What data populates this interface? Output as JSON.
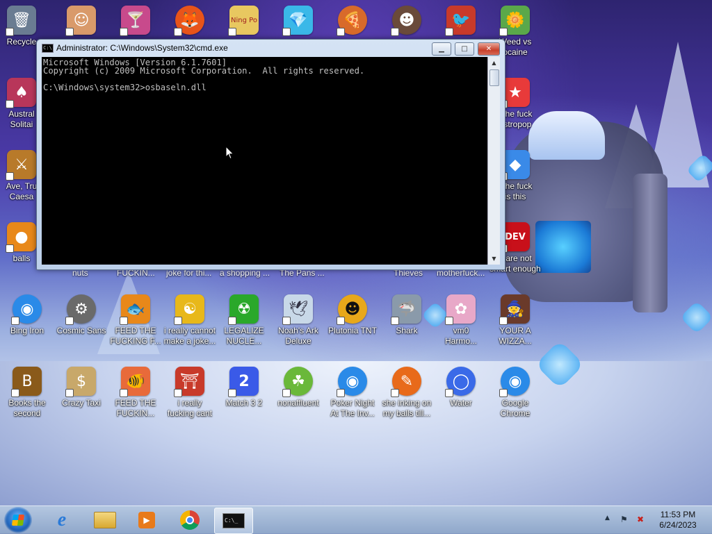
{
  "desktop": {
    "row_top": [
      {
        "label": "Recycle",
        "color": "#6a7c92",
        "glyph": "🗑"
      },
      {
        "label": "",
        "color": "#d99a6a",
        "glyph": "☺"
      },
      {
        "label": "",
        "color": "#c84a8c",
        "glyph": "🍸"
      },
      {
        "label": "",
        "color": "#e8541a",
        "glyph": "🦊"
      },
      {
        "label": "",
        "color": "#e8c860",
        "glyph": "Ning Po"
      },
      {
        "label": "",
        "color": "#3ab8e8",
        "glyph": "💎"
      },
      {
        "label": "",
        "color": "#d86a2a",
        "glyph": "🍕"
      },
      {
        "label": "",
        "color": "#6a4a3a",
        "glyph": "☻"
      },
      {
        "label": "",
        "color": "#c83a2a",
        "glyph": "🐦"
      },
      {
        "label": "Weed vs\nocaine",
        "color": "#5aa84a",
        "glyph": "🌼"
      }
    ],
    "left_col": [
      {
        "label": "Austral\nSolitai",
        "color": "#b8365a",
        "glyph": "♠"
      },
      {
        "label": "Ave, Tru\nCaesa",
        "color": "#b87a2a",
        "glyph": "⚔"
      },
      {
        "label": "balls",
        "color": "#e8881a",
        "glyph": "●"
      }
    ],
    "right_col": [
      {
        "label": "t the fuck\nastropop",
        "color": "#e83a3a",
        "glyph": "★"
      },
      {
        "label": "t the fuck\nis this",
        "color": "#3a8ae8",
        "glyph": "◆"
      },
      {
        "label": "u are not\nsmart enough",
        "color": "#c8101a",
        "glyph": "DEV"
      }
    ],
    "row_hidden_labels": [
      "nuts",
      "FUCKIN...",
      "joke for thi...",
      "a shopping ...",
      "The Pans ...",
      "Thieves",
      "motherfuck..."
    ],
    "row_middle": [
      {
        "label": "Bing Iron",
        "color": "#2a8ae8",
        "glyph": "◉"
      },
      {
        "label": "Cosmic Sans",
        "color": "#6a6a6a",
        "glyph": "⚙"
      },
      {
        "label": "FEED THE\nFUCKING F...",
        "color": "#e8881a",
        "glyph": "🐟"
      },
      {
        "label": "i really cannot\nmake a joke...",
        "color": "#e8b81a",
        "glyph": "☯"
      },
      {
        "label": "LEGALIZE\nNUCLE...",
        "color": "#2aa82a",
        "glyph": "☢"
      },
      {
        "label": "Noah's Ark\nDeluxe",
        "color": "#c8d8e8",
        "glyph": "🕊"
      },
      {
        "label": "Plutonia TNT",
        "color": "#e8a81a",
        "glyph": "☻"
      },
      {
        "label": "Shark",
        "color": "#8a9aaa",
        "glyph": "🦈"
      },
      {
        "label": "vm0\nHarmo...",
        "color": "#e8a8c8",
        "glyph": "✿"
      },
      {
        "label": "YOUR A\nWIZZA...",
        "color": "#6a3a2a",
        "glyph": "🧙"
      }
    ],
    "row_bottom": [
      {
        "label": "Books the\nsecond",
        "color": "#8a5a1a",
        "glyph": "B"
      },
      {
        "label": "Crazy Taxi",
        "color": "#c8a86a",
        "glyph": "$"
      },
      {
        "label": "FEED THE\nFUCKIN...",
        "color": "#e86a3a",
        "glyph": "🐠"
      },
      {
        "label": "i really\nfucking cant",
        "color": "#c83a2a",
        "glyph": "⛩"
      },
      {
        "label": "Match 3 2",
        "color": "#3a5ae8",
        "glyph": "2"
      },
      {
        "label": "nonaffluent",
        "color": "#6ab83a",
        "glyph": "☘"
      },
      {
        "label": "Poker Night\nAt The Inv...",
        "color": "#2a8ae8",
        "glyph": "◉"
      },
      {
        "label": "she inking on\nmy balls till...",
        "color": "#e86a1a",
        "glyph": "✎"
      },
      {
        "label": "Water",
        "color": "#3a6ae8",
        "glyph": "◯"
      },
      {
        "label": "Google\nChrome",
        "color": "#2a8ae8",
        "glyph": "◉"
      }
    ]
  },
  "cmd": {
    "title": "Administrator: C:\\Windows\\System32\\cmd.exe",
    "icon_text": "C:\\",
    "minimize": "▁",
    "maximize": "□",
    "close": "✕",
    "console_text": "Microsoft Windows [Version 6.1.7601]\nCopyright (c) 2009 Microsoft Corporation.  All rights reserved.\n\nC:\\Windows\\system32>osbaseln.dll",
    "scroll_up": "▲",
    "scroll_down": "▼"
  },
  "taskbar": {
    "pinned": [
      {
        "name": "internet-explorer",
        "glyph": "e",
        "color": "#2a7ad8"
      },
      {
        "name": "file-explorer",
        "glyph": "▤",
        "color": "#e8c050"
      },
      {
        "name": "media-player",
        "glyph": "▶",
        "color": "#e87a1a"
      },
      {
        "name": "chrome",
        "glyph": "◉",
        "color": "#2a8ae8"
      },
      {
        "name": "cmd",
        "glyph": "C:\\_",
        "color": "#111111"
      }
    ],
    "clock_time": "11:53 PM",
    "clock_date": "6/24/2023",
    "tray_arrow": "▲",
    "tray_flag": "⚑",
    "tray_network": "✖"
  }
}
